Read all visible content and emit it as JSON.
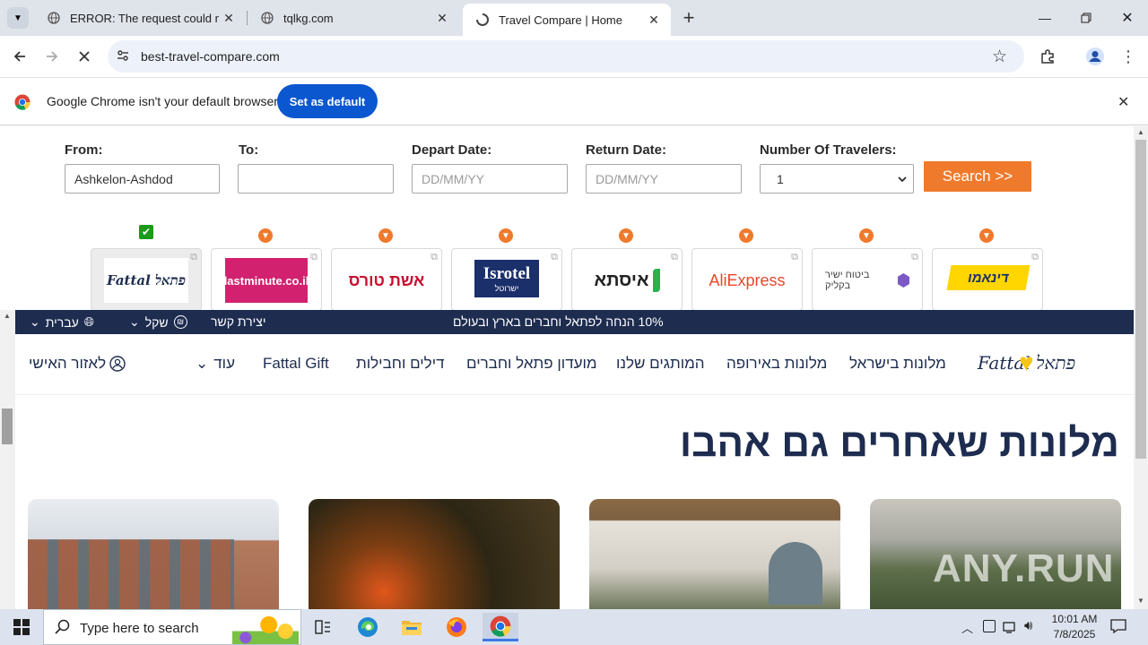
{
  "tabs": [
    {
      "title": "ERROR: The request could not be satisfied",
      "active": false
    },
    {
      "title": "tqlkg.com",
      "active": false
    },
    {
      "title": "Travel Compare | Home",
      "active": true
    }
  ],
  "toolbar": {
    "url": "best-travel-compare.com"
  },
  "infobar": {
    "message": "Google Chrome isn't your default browser",
    "button": "Set as default"
  },
  "form": {
    "from_label": "From:",
    "from_value": "Ashkelon-Ashdod",
    "to_label": "To:",
    "to_value": "",
    "depart_label": "Depart Date:",
    "depart_placeholder": "DD/MM/YY",
    "return_label": "Return Date:",
    "return_placeholder": "DD/MM/YY",
    "travelers_label": "Number Of Travelers:",
    "travelers_value": "1",
    "search_button": "Search >>"
  },
  "partners": [
    {
      "name": "fattal",
      "logo_text": "Fattal פתאל",
      "selected": true
    },
    {
      "name": "lastminute",
      "logo_text": "lastminute.co.il",
      "selected": false
    },
    {
      "name": "eshet-tours",
      "logo_text": "אשת טורס",
      "selected": false
    },
    {
      "name": "isrotel",
      "logo_text": "Isrotel",
      "logo_sub": "ישרוטל",
      "selected": false
    },
    {
      "name": "issta",
      "logo_text": "איסתא",
      "selected": false
    },
    {
      "name": "aliexpress",
      "logo_text": "AliExpress",
      "selected": false
    },
    {
      "name": "bituach",
      "logo_text": "ביטוח ישיר בקליק",
      "selected": false
    },
    {
      "name": "dinamo",
      "logo_text": "דינאמו",
      "selected": false
    }
  ],
  "fattal": {
    "promo": "10% הנחה לפתאל וחברים בארץ ובעולם",
    "contact": "יצירת קשר",
    "currency": "שקל",
    "language": "עברית",
    "nav": [
      "מלונות בישראל",
      "מלונות באירופה",
      "המותגים שלנו",
      "מועדון פתאל וחברים",
      "דילים וחבילות",
      "Fattal Gift",
      "עוד"
    ],
    "account": "לאזור האישי",
    "heading": "מלונות שאחרים גם אהבו",
    "logo": "Fattal פתאל"
  },
  "taskbar": {
    "search_placeholder": "Type here to search",
    "time": "10:01 AM",
    "date": "7/8/2025"
  },
  "watermark": "ANY.RUN",
  "colors": {
    "accent_orange": "#f07a2c",
    "navy": "#1d2c4f",
    "chrome_blue": "#0b57d0"
  }
}
